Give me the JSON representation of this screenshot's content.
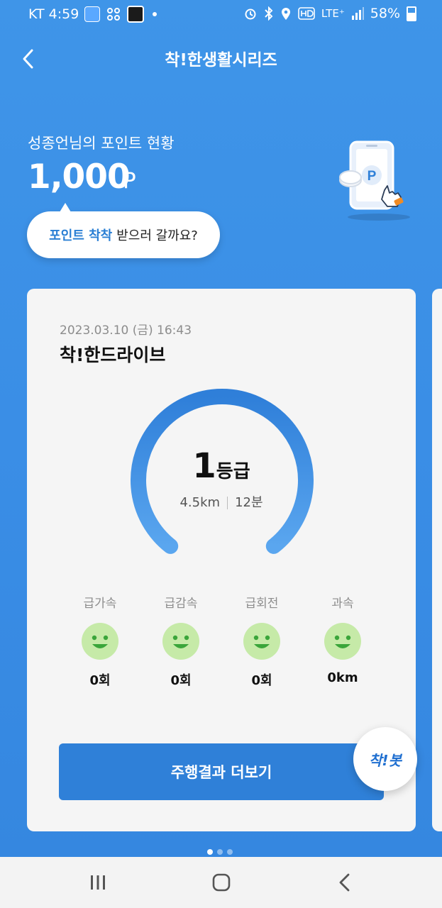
{
  "status_bar": {
    "carrier_time": "KT 4:59",
    "network": "LTE⁺",
    "battery": "58%",
    "icons": [
      "app-notification-icon",
      "fan-icon",
      "camera-app-icon",
      "alarm-icon",
      "bluetooth-icon",
      "location-icon",
      "hd-voice-icon",
      "signal-icon",
      "battery-icon"
    ]
  },
  "header": {
    "title": "착!한생활시리즈",
    "back_icon": "chevron-left-icon"
  },
  "points": {
    "label": "성종언님의 포인트 현황",
    "value": "1,000",
    "unit": "P",
    "illustration_icon": "phone-point-icon"
  },
  "bubble": {
    "highlight": "포인트 착착",
    "text": "받으러 갈까요?"
  },
  "card": {
    "date": "2023.03.10 (금) 16:43",
    "title": "착!한드라이브",
    "grade_number": "1",
    "grade_unit": "등급",
    "distance": "4.5km",
    "duration": "12분",
    "metrics": [
      {
        "label": "급가속",
        "value": "0회"
      },
      {
        "label": "급감속",
        "value": "0회"
      },
      {
        "label": "급회전",
        "value": "0회"
      },
      {
        "label": "과속",
        "value": "0km"
      }
    ],
    "cta_label": "주행결과 더보기"
  },
  "fab": {
    "label": "착!봇"
  },
  "pager": {
    "count": 3,
    "active": 0
  },
  "nav_bar": {
    "icons": [
      "recent-apps-icon",
      "home-icon",
      "back-icon"
    ]
  },
  "colors": {
    "background": "#3a8ee6",
    "accent": "#2f80d8",
    "smiley": "#c6eaa8",
    "smiley_face": "#3aa53a"
  }
}
